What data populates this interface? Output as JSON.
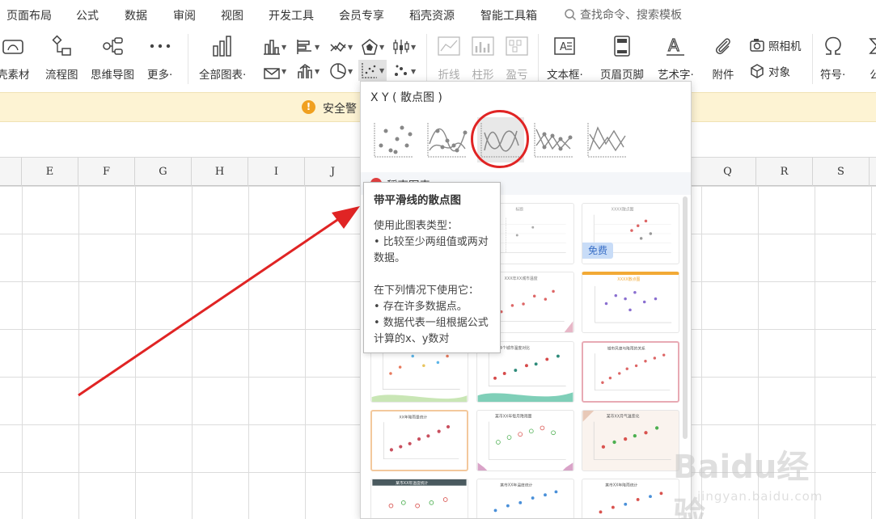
{
  "menu": {
    "items": [
      "页面布局",
      "公式",
      "数据",
      "审阅",
      "视图",
      "开发工具",
      "会员专享",
      "稻壳资源",
      "智能工具箱"
    ],
    "search_placeholder": "查找命令、搜索模板"
  },
  "ribbon": {
    "left_buttons": [
      {
        "label": "壳素材",
        "icon": "material-icon"
      },
      {
        "label": "流程图",
        "icon": "flowchart-icon"
      },
      {
        "label": "思维导图",
        "icon": "mindmap-icon"
      },
      {
        "label": "更多·",
        "icon": "more-icon"
      }
    ],
    "all_charts": {
      "label": "全部图表·",
      "icon": "bar-chart-icon"
    },
    "chart_icons_row1": [
      "column-chart-icon",
      "bar-chart-horizontal-icon",
      "line-chart-icon",
      "radar-chart-icon",
      "stock-chart-icon"
    ],
    "chart_icons_row2": [
      "combo-chart-icon",
      "area-chart-icon",
      "pie-chart-icon",
      "scatter-chart-icon",
      "bubble-chart-icon"
    ],
    "sparklines": [
      {
        "label": "折线",
        "icon": "sparkline-line-icon"
      },
      {
        "label": "柱形",
        "icon": "sparkline-column-icon"
      },
      {
        "label": "盈亏",
        "icon": "sparkline-winloss-icon"
      }
    ],
    "insert_buttons": [
      {
        "label": "文本框·",
        "icon": "textbox-icon"
      },
      {
        "label": "页眉页脚",
        "icon": "header-footer-icon"
      },
      {
        "label": "艺术字·",
        "icon": "wordart-icon"
      },
      {
        "label": "附件",
        "icon": "attachment-icon"
      }
    ],
    "camera": {
      "label": "照相机",
      "icon": "camera-icon"
    },
    "object": {
      "label": "对象",
      "icon": "object-icon"
    },
    "symbol": {
      "label": "符号·",
      "icon": "omega-icon"
    },
    "formula_partial": "公"
  },
  "security_bar": {
    "text": "安全警",
    "icon": "warning-icon",
    "color": "#f0a020"
  },
  "columns": [
    "E",
    "F",
    "G",
    "H",
    "I",
    "J",
    "Q",
    "R",
    "S"
  ],
  "panel": {
    "title": "X Y ( 散点图 )",
    "types": [
      "scatter-dots-icon",
      "scatter-smooth-markers-icon",
      "scatter-smooth-lines-icon",
      "scatter-straight-markers-icon",
      "scatter-straight-lines-icon"
    ],
    "selected_index": 2,
    "section_title": "稻壳图表",
    "free_label": "免费"
  },
  "tooltip": {
    "title": "带平滑线的散点图",
    "use_heading": "使用此图表类型：",
    "use_item": "• 比较至少两组值或两对数据。",
    "when_heading": "在下列情况下使用它：",
    "when_item1": "• 存在许多数据点。",
    "when_item2": "• 数据代表一组根据公式计算的x、y数对"
  },
  "watermark": {
    "line1": "Baidu经验",
    "line2": "jingyan.baidu.com"
  },
  "colors": {
    "accent_red": "#e02424",
    "security_bg": "#fdf3d3",
    "free_tag_bg": "#c8dcf7"
  }
}
